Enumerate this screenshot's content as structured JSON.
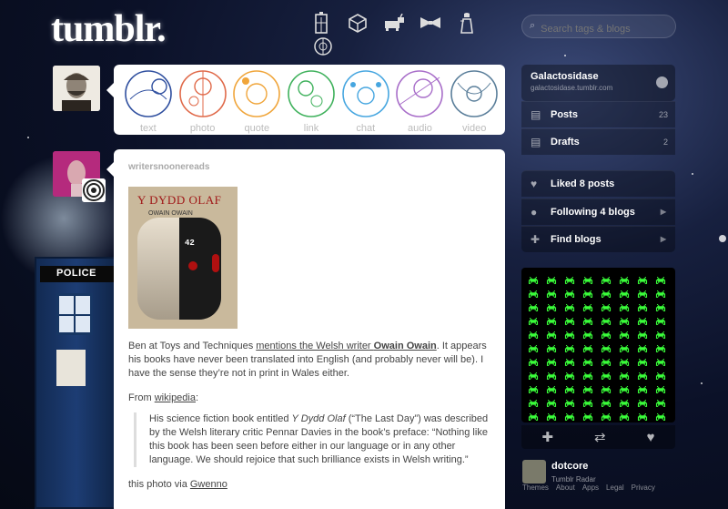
{
  "header": {
    "logo": "tumblr.",
    "search_placeholder": "Search tags & blogs",
    "nav_icons": [
      "tardis-icon",
      "cube-icon",
      "k9-dog-icon",
      "bowtie-icon",
      "dalek-icon",
      "gallifrey-symbol-icon"
    ]
  },
  "post_types": [
    {
      "label": "text"
    },
    {
      "label": "photo"
    },
    {
      "label": "quote"
    },
    {
      "label": "link"
    },
    {
      "label": "chat"
    },
    {
      "label": "audio"
    },
    {
      "label": "video"
    }
  ],
  "post_type_colors": [
    "#2f4f9f",
    "#e06a4a",
    "#f0a53a",
    "#3fb15c",
    "#46a6e0",
    "#a86ec9",
    "#5a7e9a"
  ],
  "post": {
    "author": "writersnoonereads",
    "book_title": "Y DYDD OLAF",
    "book_author": "OWAIN OWAIN",
    "book_number": "42",
    "para1_a": "Ben at Toys and Techniques ",
    "para1_link": "mentions the Welsh writer ",
    "para1_link_bold": "Owain Owain",
    "para1_b": ". It appears his books have never been translated into English (and probably never will be). I have the sense they’re not in print in Wales either.",
    "from_label": "From ",
    "from_link": "wikipedia",
    "from_colon": ":",
    "quote_a": "His science fiction book entitled ",
    "quote_title": "Y Dydd Olaf",
    "quote_b": " (“The Last Day”) was described by the Welsh literary critic Pennar Davies in the book’s preface: “Nothing like this book has been seen before either in our language or in any other language. We should rejoice that such brilliance exists in Welsh writing.”",
    "via_label": "this photo via ",
    "via_link": "Gwenno"
  },
  "sidebar": {
    "blog_name": "Galactosidase",
    "blog_url": "galactosidase.tumblr.com",
    "rows": [
      {
        "label": "Posts",
        "count": "23"
      },
      {
        "label": "Drafts",
        "count": "2"
      }
    ],
    "liked": "Liked 8 posts",
    "following": "Following 4 blogs",
    "find": "Find blogs",
    "radar_invader_color": "#3aff3a",
    "radar_user": "dotcore",
    "radar_label": "Tumblr Radar",
    "footer_links": [
      "Themes",
      "About",
      "Apps",
      "Legal",
      "Privacy"
    ]
  }
}
